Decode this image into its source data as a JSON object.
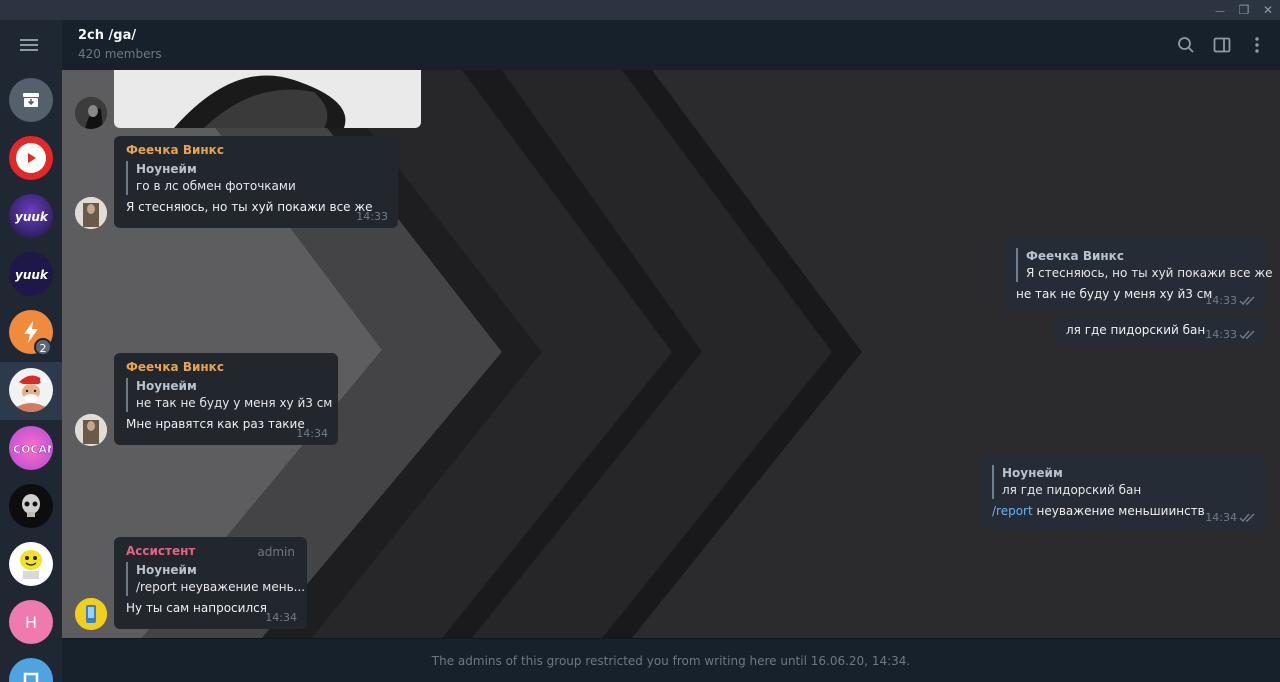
{
  "window": {
    "buttons": [
      {
        "name": "minimize",
        "glyph": "—"
      },
      {
        "name": "restore",
        "glyph": "❐"
      },
      {
        "name": "close",
        "glyph": "✕"
      }
    ]
  },
  "sidebar": {
    "chats": [
      {
        "name": "archive",
        "badge": ""
      },
      {
        "name": "youtube-channel",
        "badge": ""
      },
      {
        "name": "yuuk-chat-1",
        "badge": ""
      },
      {
        "name": "yuuk-chat-2",
        "badge": ""
      },
      {
        "name": "lightning-chat",
        "badge": "2"
      },
      {
        "name": "2ch-ga",
        "badge": ""
      },
      {
        "name": "cocan-chat",
        "badge": ""
      },
      {
        "name": "skull-chat",
        "badge": ""
      },
      {
        "name": "yellow-chat",
        "badge": ""
      },
      {
        "name": "h-chat",
        "badge": "",
        "letter": "H"
      },
      {
        "name": "blue-chat",
        "badge": ""
      }
    ]
  },
  "header": {
    "title": "2ch /ga/",
    "subtitle": "420 members"
  },
  "messages": {
    "m1": {
      "sender": "Феечка Винкс",
      "quote_name": "Ноунейм",
      "quote_text": "го в лс обмен фоточками",
      "text": "Я стесняюсь, но ты хуй покажи все же",
      "time": "14:33"
    },
    "m2": {
      "quote_name": "Феечка Винкс",
      "quote_text": "Я стесняюсь, но ты хуй покажи все же",
      "text": "не так не буду у меня ху й3 см",
      "time": "14:33"
    },
    "m3": {
      "text": "ля где пидорский бан",
      "time": "14:33"
    },
    "m4": {
      "sender": "Феечка Винкс",
      "quote_name": "Ноунейм",
      "quote_text": "не так не буду у меня ху й3 см",
      "text": "Мне нравятся как раз такие",
      "time": "14:34"
    },
    "m5": {
      "quote_name": "Ноунейм",
      "quote_text": "ля где пидорский бан",
      "command": "/report",
      "text": " неуважение меньшиинств",
      "time": "14:34"
    },
    "m6": {
      "sender": "Ассистент",
      "role": "admin",
      "quote_name": "Ноунейм",
      "quote_text": "/report неуважение мень...",
      "text": "Ну ты сам напросился",
      "time": "14:34"
    }
  },
  "footer": {
    "notice": "The admins of this group restricted you from writing here until 16.06.20, 14:34."
  },
  "colors": {
    "sender_winx": "#e8a350",
    "sender_assistant": "#e5637f",
    "link": "#6ab2f2"
  }
}
